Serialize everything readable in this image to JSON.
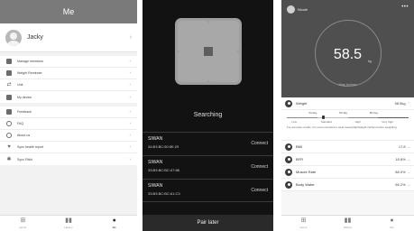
{
  "me": {
    "title": "Me",
    "profile_name": "Jacky",
    "menu": [
      {
        "icon": "users-icon",
        "label": "Manage members"
      },
      {
        "icon": "bell-icon",
        "label": "Weight Reminder"
      },
      {
        "icon": "unit-icon",
        "label": "Unit"
      },
      {
        "icon": "device-icon",
        "label": "My device"
      },
      {
        "icon": "feedback-icon",
        "label": "Feedback"
      },
      {
        "icon": "faq-icon",
        "label": "FAQ"
      },
      {
        "icon": "info-icon",
        "label": "About us"
      },
      {
        "icon": "health-icon",
        "label": "Sync health report"
      },
      {
        "icon": "sync-icon",
        "label": "Sync Fitbit"
      }
    ],
    "tabs": [
      {
        "icon": "home-icon",
        "label": "Home"
      },
      {
        "icon": "history-icon",
        "label": "History"
      },
      {
        "icon": "me-icon",
        "label": "Me"
      }
    ]
  },
  "search": {
    "status": "Searching",
    "devices": [
      {
        "name": "SIWAN",
        "mac": "34:B3:BC:50:5E:29",
        "action": "Connect"
      },
      {
        "name": "SIWAN",
        "mac": "33:B3:BC:BC:47:88",
        "action": "Connect"
      },
      {
        "name": "SIWAN",
        "mac": "33:B3:BC:BC:61:C3",
        "action": "Connect"
      }
    ],
    "pair_later": "Pair later"
  },
  "weight": {
    "user": "Nicole",
    "more": "•••",
    "value": "58.5",
    "unit": "kg",
    "subtitle": "May before",
    "rows": [
      {
        "name": "Weight",
        "value": "58.5kg"
      },
      {
        "name": "BMI",
        "value": "17.8"
      },
      {
        "name": "BFR",
        "value": "18.8%"
      },
      {
        "name": "Muscle Rate",
        "value": "88.0%"
      },
      {
        "name": "Body Water",
        "value": "56.2%"
      }
    ],
    "scale_numbers": [
      "53.2kg",
      "59.4kg",
      "80.1kg"
    ],
    "scale_labels": [
      "Low",
      "Standard",
      "High",
      "Very high"
    ],
    "scale_position": 0.3,
    "note": "For accurate results, it is recommended to wear lossely/lightweight clothes before weighting.",
    "tabs": [
      {
        "icon": "home-icon",
        "label": "Home"
      },
      {
        "icon": "history-icon",
        "label": "History"
      },
      {
        "icon": "me-icon",
        "label": "Me"
      }
    ],
    "colors": {
      "low": "#8a8a8a",
      "standard": "#bdbdbd",
      "high": "#8a8a8a",
      "very_high": "#5a5a5a"
    }
  }
}
